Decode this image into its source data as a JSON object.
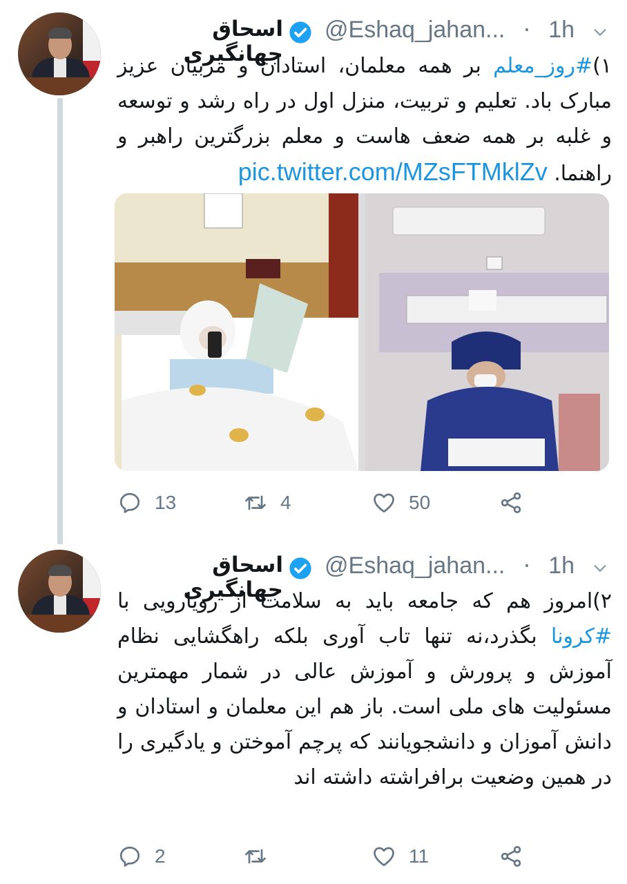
{
  "tweets": [
    {
      "name": "اسحاق جهانگیری",
      "handle": "@Eshaq_jahan...",
      "separator": "·",
      "time": "1h",
      "text_prefix": "۱)",
      "hashtag": "#روز_معلم",
      "text_body": " بر همه معلمان، استادان و مربیان عزیز مبارک باد. تعلیم و تربیت، منزل اول در راه رشد و توسعه و غلبه بر همه ضعف هاست و معلم بزرگترین راهبر و راهنما. ",
      "link": "pic.twitter.com/MZsFTMklZv",
      "replies": "13",
      "retweets": "4",
      "likes": "50"
    },
    {
      "name": "اسحاق جهانگیری",
      "handle": "@Eshaq_jahan...",
      "separator": "·",
      "time": "1h",
      "text_prefix": "۲)امروز هم که جامعه باید به سلامت از رویارویی با ",
      "hashtag": "#کرونا",
      "text_body": " بگذرد،نه تنها تاب آوری بلکه راهگشایی نظام آموزش و پرورش و آموزش عالی در شمار مهمترین مسئولیت های ملی است. باز هم این معلمان و استادان و دانش آموزان و دانشجویانند که پرچم آموختن و یادگیری را در همین وضعیت برافراشته داشته اند",
      "replies": "2",
      "retweets": "",
      "likes": "11"
    }
  ],
  "icons": {
    "verified": "verified-badge-icon",
    "more": "chevron-down-icon",
    "reply": "reply-icon",
    "retweet": "retweet-icon",
    "like": "heart-icon",
    "share": "share-icon"
  },
  "colors": {
    "link": "#1b95e0",
    "verified": "#1da1f2",
    "muted": "#657786",
    "thread_line": "#cfd9de"
  }
}
